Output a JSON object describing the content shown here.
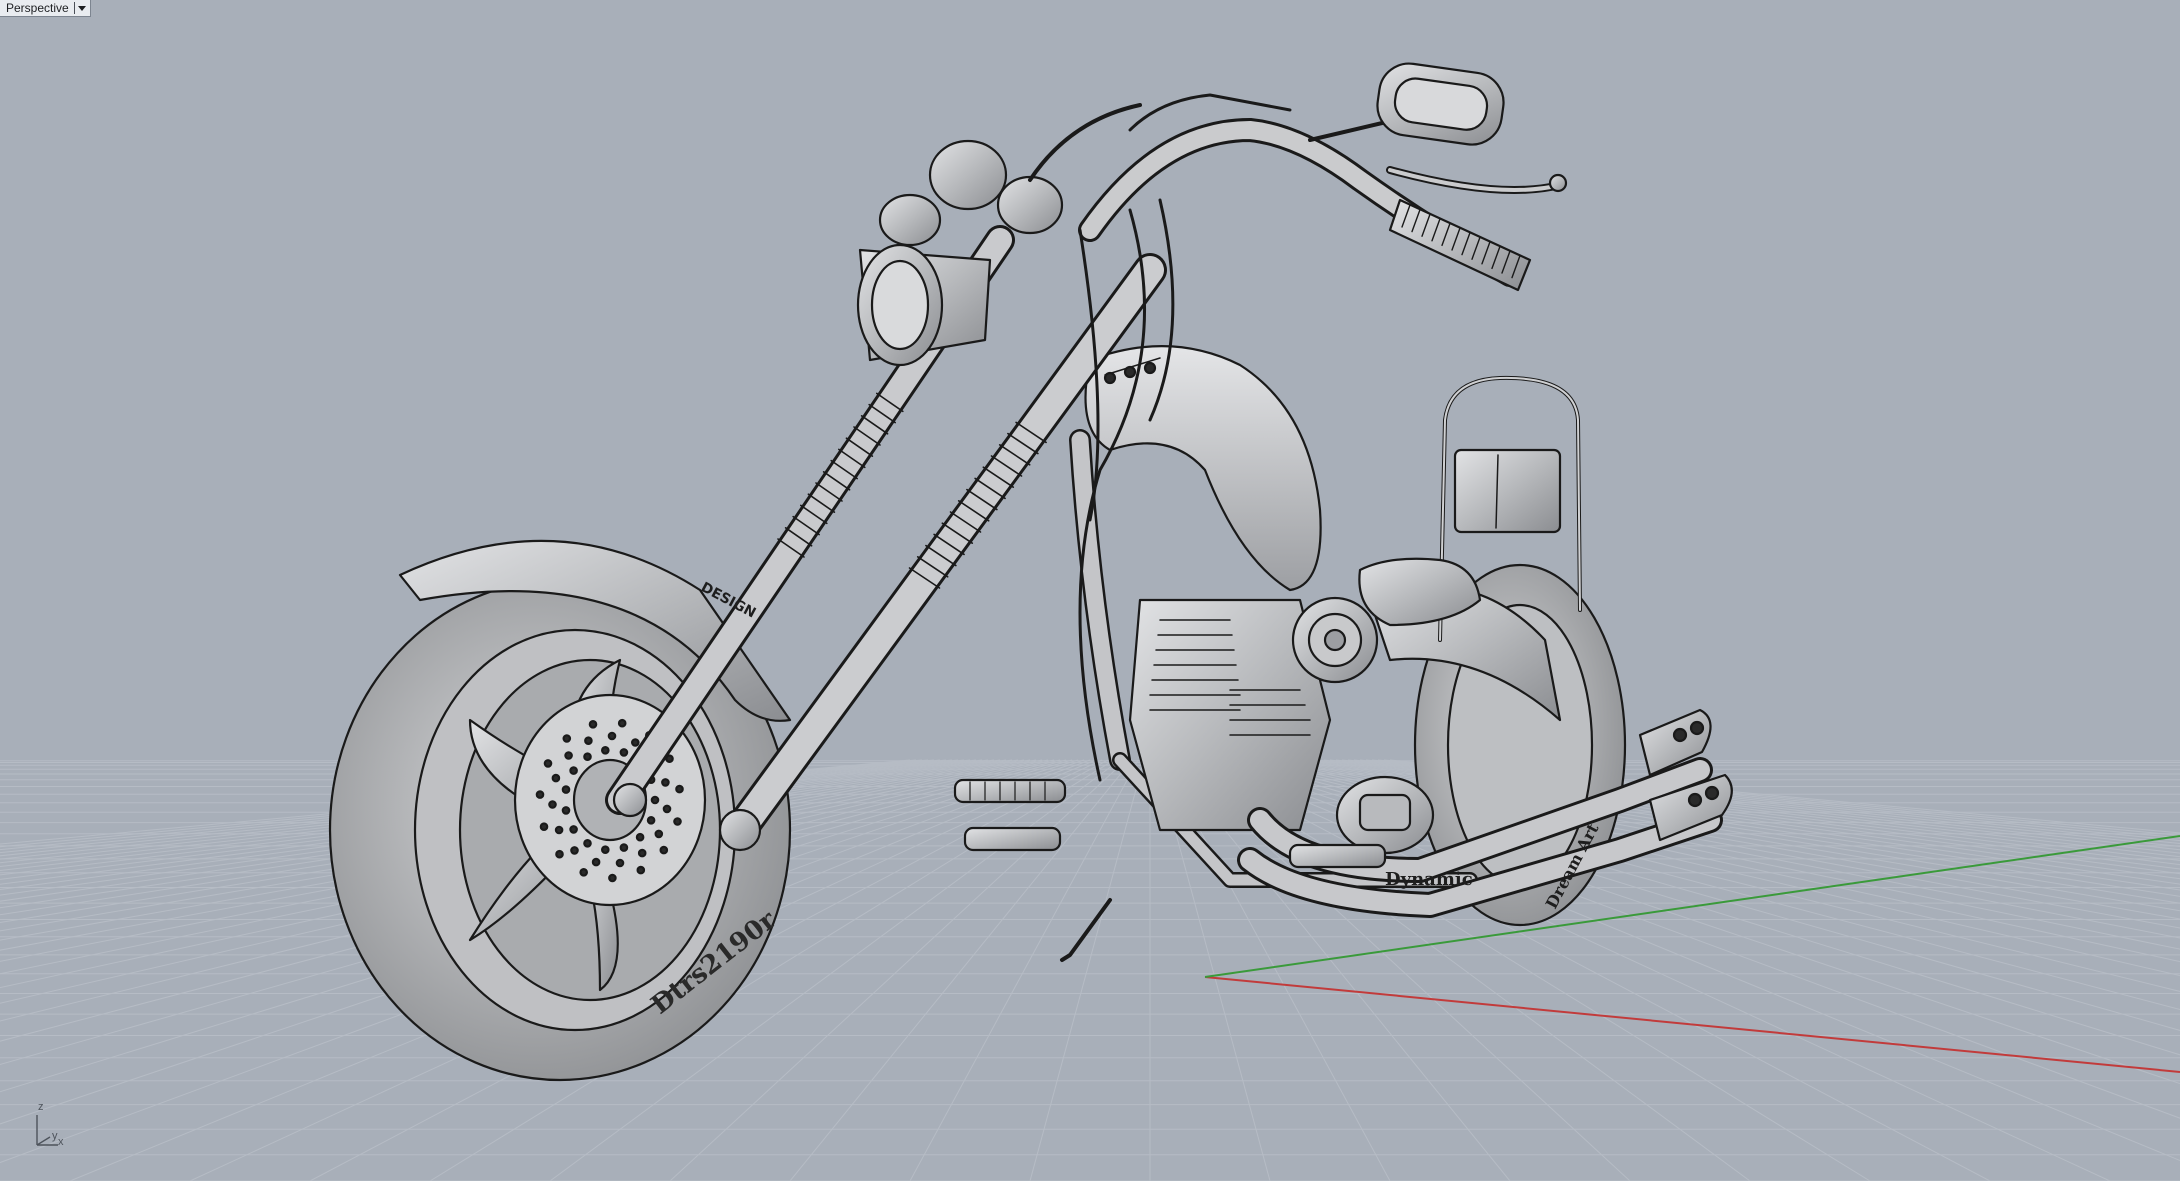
{
  "viewport": {
    "name": "Perspective",
    "menu_icon": "dropdown-arrow-icon"
  },
  "model": {
    "tire_front_text": "Dtrs2190r",
    "engine_cover_text": "Dynamic",
    "tire_rear_text": "Dream Art",
    "fork_text": "DESIGN"
  },
  "axis_widget": {
    "z_label": "z",
    "x_label": "x",
    "y_label": "y"
  },
  "colors": {
    "background": "#a8afb9",
    "grid": "#b8bec7",
    "x_axis": "#c23b3b",
    "y_axis": "#3a9a3a",
    "model_fill": "#c9cacc",
    "model_line": "#1a1a1a"
  }
}
